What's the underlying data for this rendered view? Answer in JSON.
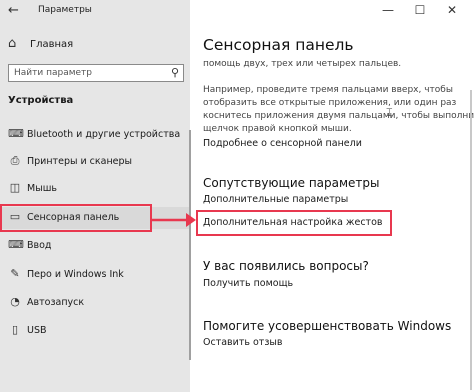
{
  "window": {
    "title": "Параметры",
    "back_icon": "back-arrow-icon",
    "controls": [
      "minimize-icon",
      "maximize-icon",
      "close-icon"
    ],
    "control_glyphs": [
      "—",
      "☐",
      "✕"
    ]
  },
  "sidebar": {
    "home_label": "Главная",
    "search_placeholder": "Найти параметр",
    "section_title": "Устройства",
    "items": [
      {
        "label": "Bluetooth и другие устройства",
        "icon": "bluetooth-icon",
        "glyph": "⌨"
      },
      {
        "label": "Принтеры и сканеры",
        "icon": "printer-icon",
        "glyph": "⎙"
      },
      {
        "label": "Мышь",
        "icon": "mouse-icon",
        "glyph": "◫"
      },
      {
        "label": "Сенсорная панель",
        "icon": "touchpad-icon",
        "glyph": "▭",
        "active": true
      },
      {
        "label": "Ввод",
        "icon": "keyboard-icon",
        "glyph": "⌨"
      },
      {
        "label": "Перо и Windows Ink",
        "icon": "pen-icon",
        "glyph": "✎"
      },
      {
        "label": "Автозапуск",
        "icon": "autoplay-icon",
        "glyph": "◔"
      },
      {
        "label": "USB",
        "icon": "usb-icon",
        "glyph": "▯"
      }
    ]
  },
  "main": {
    "title": "Сенсорная панель",
    "intro_line": "помощь двух, трех или четырех пальцев.",
    "paragraph_lines": [
      "Например, проведите тремя пальцами вверх, чтобы",
      "отобразить все открытые приложения, или один раз",
      "коснитесь приложения двумя пальцами, чтобы выполнить",
      "щелчок правой кнопкой мыши."
    ],
    "learn_more_link": "Подробнее о сенсорной панели",
    "related_title": "Сопутствующие параметры",
    "related_links": [
      "Дополнительные параметры",
      "Дополнительная настройка жестов"
    ],
    "questions_title": "У вас появились вопросы?",
    "help_link": "Получить помощь",
    "improve_title": "Помогите усовершенствовать Windows",
    "feedback_link": "Оставить отзыв"
  },
  "colors": {
    "highlight": "#e8384f",
    "sidebar_bg": "#e6e6e6",
    "active_item_bg": "#d9d9d9"
  }
}
